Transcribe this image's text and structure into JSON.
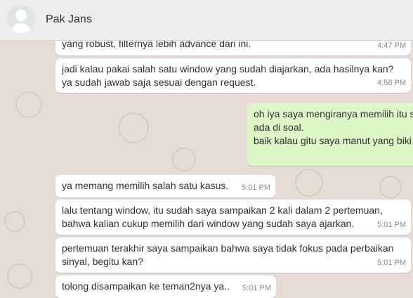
{
  "header": {
    "contact_name": "Pak Jans"
  },
  "messages": [
    {
      "direction": "in",
      "text": "yang robust, filternya lebih advance dari ini.",
      "time": "4:47 PM"
    },
    {
      "direction": "in",
      "text": "jadi kalau pakai salah satu window yang sudah diajarkan, ada hasilnya kan?\nya sudah jawab saja sesuai dengan request.",
      "time": "4:58 PM"
    },
    {
      "direction": "out",
      "text": "oh iya saya mengiranya memilih itu s\nada di soal.\nbaik kalau gitu saya manut yang biki",
      "time": ""
    },
    {
      "direction": "in",
      "text": "ya memang memilih salah satu kasus.",
      "time": "5:01 PM"
    },
    {
      "direction": "in",
      "text": "lalu tentang window, itu sudah saya sampaikan 2 kali dalam 2 pertemuan,\nbahwa kalian cukup memilih dari window yang sudah saya ajarkan.",
      "time": "5:01 PM"
    },
    {
      "direction": "in",
      "text": "pertemuan terakhir saya sampaikan bahwa saya tidak fokus pada perbaikan\nsinyal, begitu kan?",
      "time": "5:01 PM"
    },
    {
      "direction": "in",
      "text": "tolong disampaikan ke teman2nya ya..",
      "time": "5:01 PM"
    }
  ],
  "colors": {
    "wallpaper": "#e5ddd5",
    "incoming_bubble": "#ffffff",
    "outgoing_bubble": "#dcf8c6",
    "header_bg": "#ededed"
  }
}
